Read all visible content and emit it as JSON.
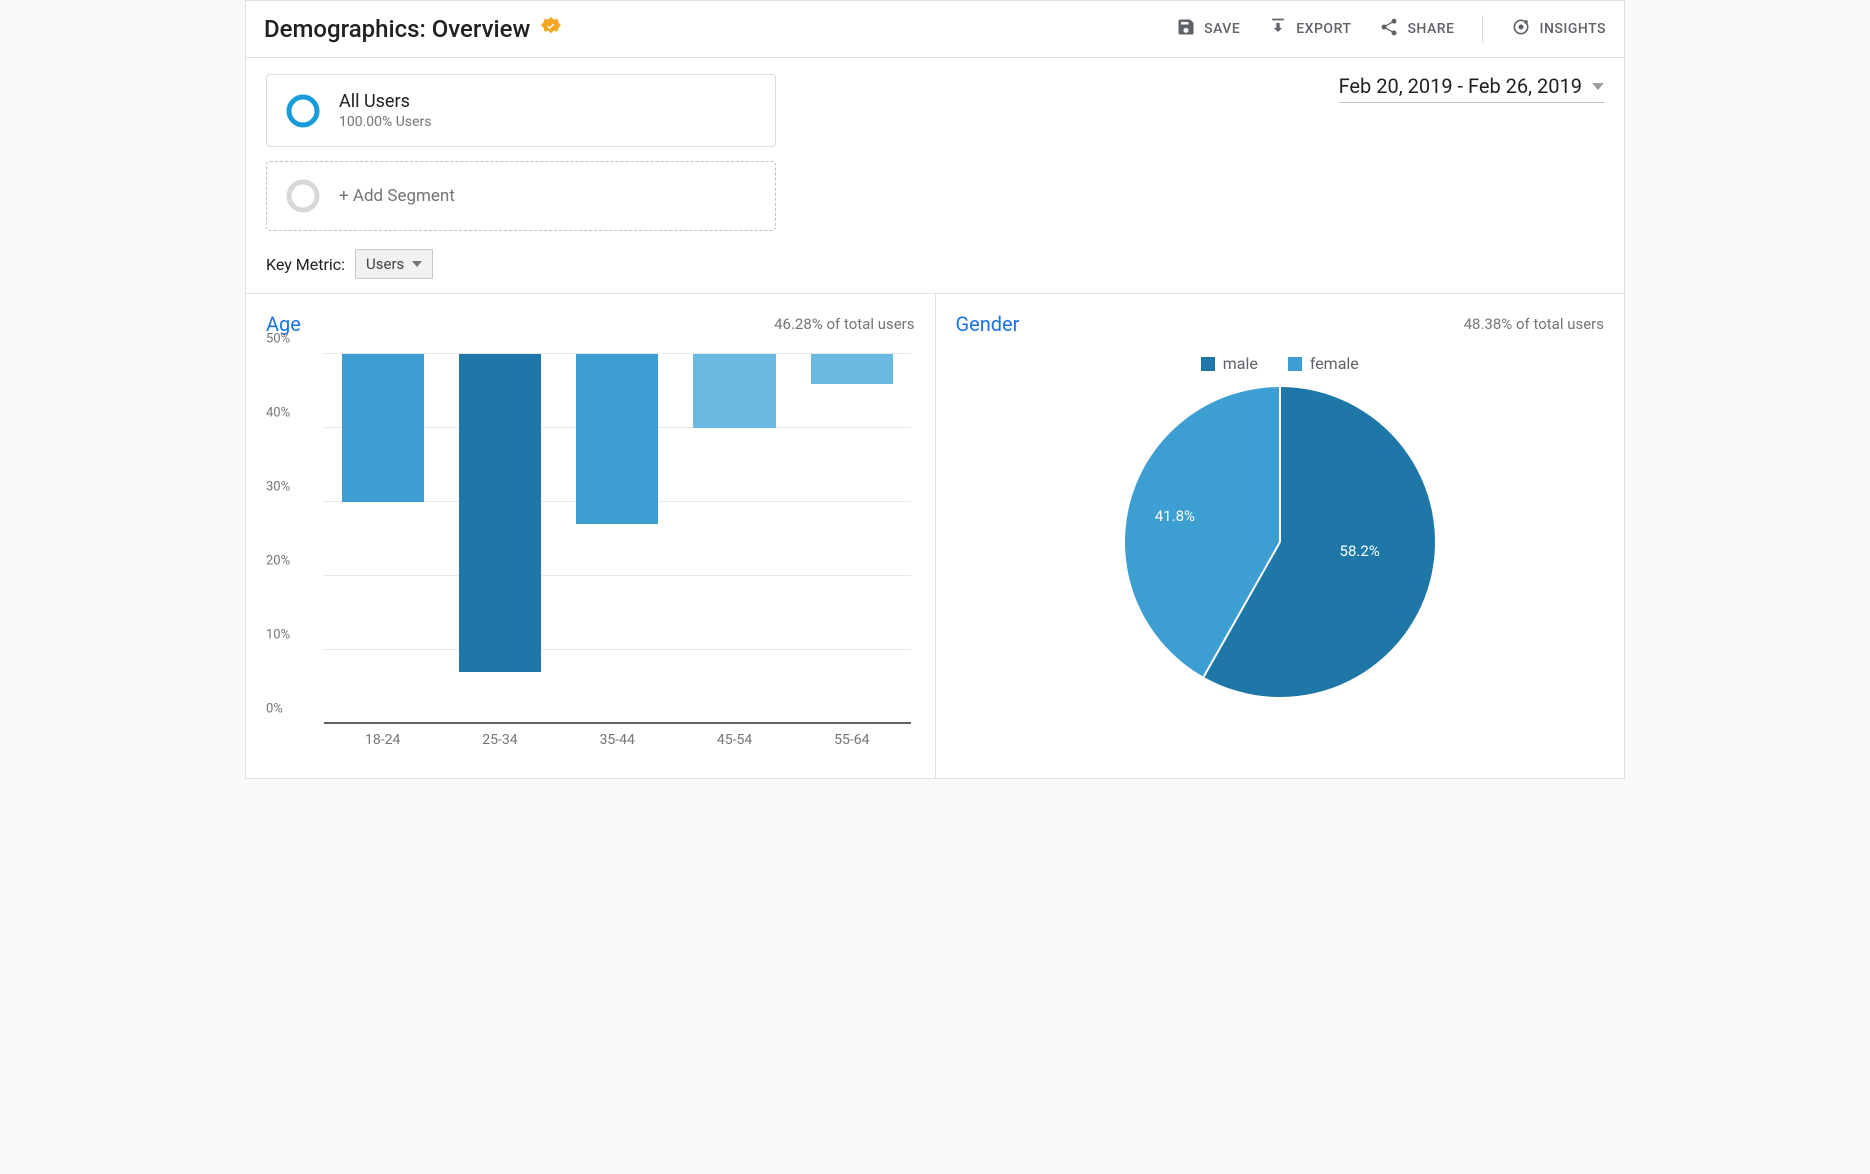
{
  "header": {
    "title": "Demographics: Overview",
    "actions": {
      "save": "SAVE",
      "export": "EXPORT",
      "share": "SHARE",
      "insights": "INSIGHTS"
    }
  },
  "segment": {
    "active_title": "All Users",
    "active_sub": "100.00% Users",
    "add_label": "+ Add Segment"
  },
  "date_range": "Feb 20, 2019 - Feb 26, 2019",
  "key_metric": {
    "label": "Key Metric:",
    "selected": "Users"
  },
  "panels": {
    "age": {
      "title": "Age",
      "subtitle": "46.28% of total users"
    },
    "gender": {
      "title": "Gender",
      "subtitle": "48.38% of total users",
      "legend": {
        "male": "male",
        "female": "female"
      },
      "labels": {
        "male": "58.2%",
        "female": "41.8%"
      }
    }
  },
  "colors": {
    "bar_light": "#69b9e0",
    "bar_mid": "#3d9fd1",
    "bar_dark": "#1f77a8",
    "male": "#1f77a8",
    "female": "#3d9fd1"
  },
  "chart_data": [
    {
      "type": "bar",
      "title": "Age",
      "xlabel": "",
      "ylabel": "",
      "ylim": [
        0,
        50
      ],
      "yticks": [
        0,
        10,
        20,
        30,
        40,
        50
      ],
      "ytick_labels": [
        "0%",
        "10%",
        "20%",
        "30%",
        "40%",
        "50%"
      ],
      "categories": [
        "18-24",
        "25-34",
        "35-44",
        "45-54",
        "55-64"
      ],
      "values": [
        20,
        43,
        23,
        10,
        4
      ],
      "bar_shades": [
        "mid",
        "dark",
        "mid",
        "light",
        "light"
      ]
    },
    {
      "type": "pie",
      "title": "Gender",
      "series": [
        {
          "name": "male",
          "value": 58.2
        },
        {
          "name": "female",
          "value": 41.8
        }
      ]
    }
  ]
}
